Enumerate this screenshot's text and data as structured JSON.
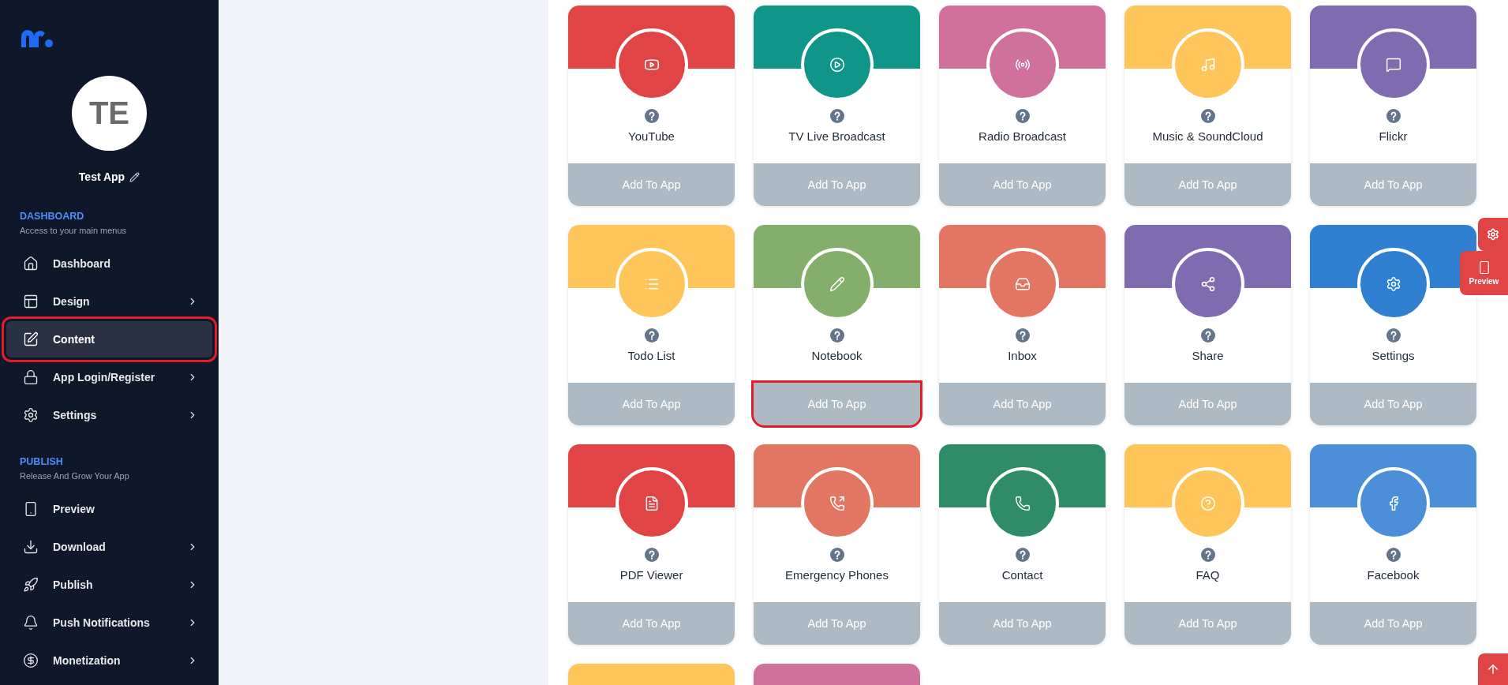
{
  "sidebar": {
    "app_name": "Test App",
    "avatar_initials": "TE",
    "sections": [
      {
        "title": "DASHBOARD",
        "subtitle": "Access to your main menus",
        "items": [
          {
            "label": "Dashboard",
            "selected": false,
            "highlighted": false,
            "submenu": false
          },
          {
            "label": "Design",
            "selected": false,
            "highlighted": false,
            "submenu": true
          },
          {
            "label": "Content",
            "selected": true,
            "highlighted": true,
            "submenu": false
          },
          {
            "label": "App Login/Register",
            "selected": false,
            "highlighted": false,
            "submenu": true
          },
          {
            "label": "Settings",
            "selected": false,
            "highlighted": false,
            "submenu": true
          }
        ]
      },
      {
        "title": "PUBLISH",
        "subtitle": "Release And Grow Your App",
        "items": [
          {
            "label": "Preview",
            "selected": false,
            "highlighted": false,
            "submenu": false
          },
          {
            "label": "Download",
            "selected": false,
            "highlighted": false,
            "submenu": true
          },
          {
            "label": "Publish",
            "selected": false,
            "highlighted": false,
            "submenu": true
          },
          {
            "label": "Push Notifications",
            "selected": false,
            "highlighted": false,
            "submenu": true
          },
          {
            "label": "Monetization",
            "selected": false,
            "highlighted": false,
            "submenu": true
          }
        ]
      }
    ]
  },
  "cards": [
    {
      "name": "YouTube",
      "color": "#e04444",
      "button": "Add To App",
      "highlighted": false
    },
    {
      "name": "TV Live Broadcast",
      "color": "#0f9688",
      "button": "Add To App",
      "highlighted": false
    },
    {
      "name": "Radio Broadcast",
      "color": "#d0709c",
      "button": "Add To App",
      "highlighted": false
    },
    {
      "name": "Music & SoundCloud",
      "color": "#fdc55a",
      "button": "Add To App",
      "highlighted": false
    },
    {
      "name": "Flickr",
      "color": "#7e6bb0",
      "button": "Add To App",
      "highlighted": false
    },
    {
      "name": "Todo List",
      "color": "#fdc55a",
      "button": "Add To App",
      "highlighted": false
    },
    {
      "name": "Notebook",
      "color": "#84ae6c",
      "button": "Add To App",
      "highlighted": true
    },
    {
      "name": "Inbox",
      "color": "#e27662",
      "button": "Add To App",
      "highlighted": false
    },
    {
      "name": "Share",
      "color": "#7e6bb0",
      "button": "Add To App",
      "highlighted": false
    },
    {
      "name": "Settings",
      "color": "#2f80d0",
      "button": "Add To App",
      "highlighted": false
    },
    {
      "name": "PDF Viewer",
      "color": "#e04444",
      "button": "Add To App",
      "highlighted": false
    },
    {
      "name": "Emergency Phones",
      "color": "#e27662",
      "button": "Add To App",
      "highlighted": false
    },
    {
      "name": "Contact",
      "color": "#2e8c68",
      "button": "Add To App",
      "highlighted": false
    },
    {
      "name": "FAQ",
      "color": "#fdc55a",
      "button": "Add To App",
      "highlighted": false
    },
    {
      "name": "Facebook",
      "color": "#4a8fd8",
      "button": "Add To App",
      "highlighted": false
    },
    {
      "color": "#fdc55a"
    },
    {
      "color": "#d0709c"
    }
  ],
  "floating": {
    "preview_label": "Preview"
  }
}
